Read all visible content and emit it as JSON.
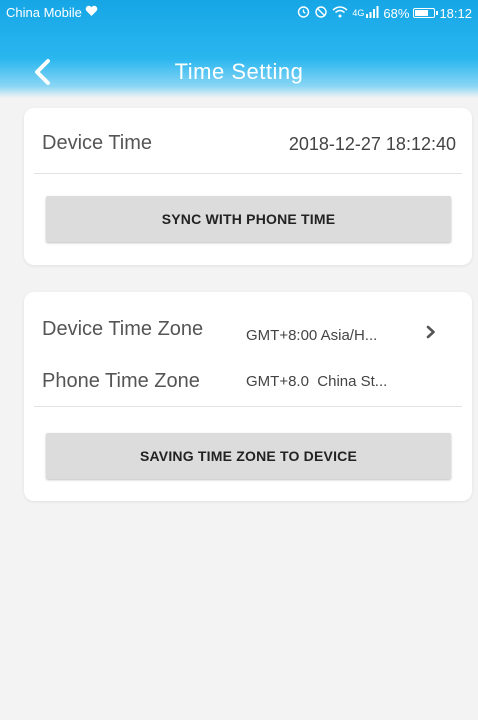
{
  "status_bar": {
    "carrier": "China Mobile",
    "battery": "68%",
    "battery_level": 0.68,
    "time": "18:12",
    "signal_label": "4G",
    "icons": [
      "heart-icon",
      "alarm-icon",
      "mute-icon",
      "wifi-icon",
      "signal-icon",
      "battery-icon"
    ]
  },
  "header": {
    "title": "Time Setting",
    "back_icon": "chevron-left-icon"
  },
  "device_time": {
    "label": "Device Time",
    "value": "2018-12-27 18:12:40",
    "sync_button": "SYNC WITH PHONE TIME"
  },
  "time_zone": {
    "device_label": "Device Time Zone",
    "device_value": "GMT+8:00 Asia/H...",
    "phone_label": "Phone Time Zone",
    "phone_value": "GMT+8.0  China St...",
    "save_button": "SAVING TIME ZONE TO DEVICE",
    "chevron_icon": "chevron-right-icon"
  },
  "colors": {
    "header_top": "#16a6e6",
    "header_bottom": "#8ad6f5",
    "background": "#f3f3f3",
    "card": "#ffffff",
    "button": "#dcdcdc"
  }
}
